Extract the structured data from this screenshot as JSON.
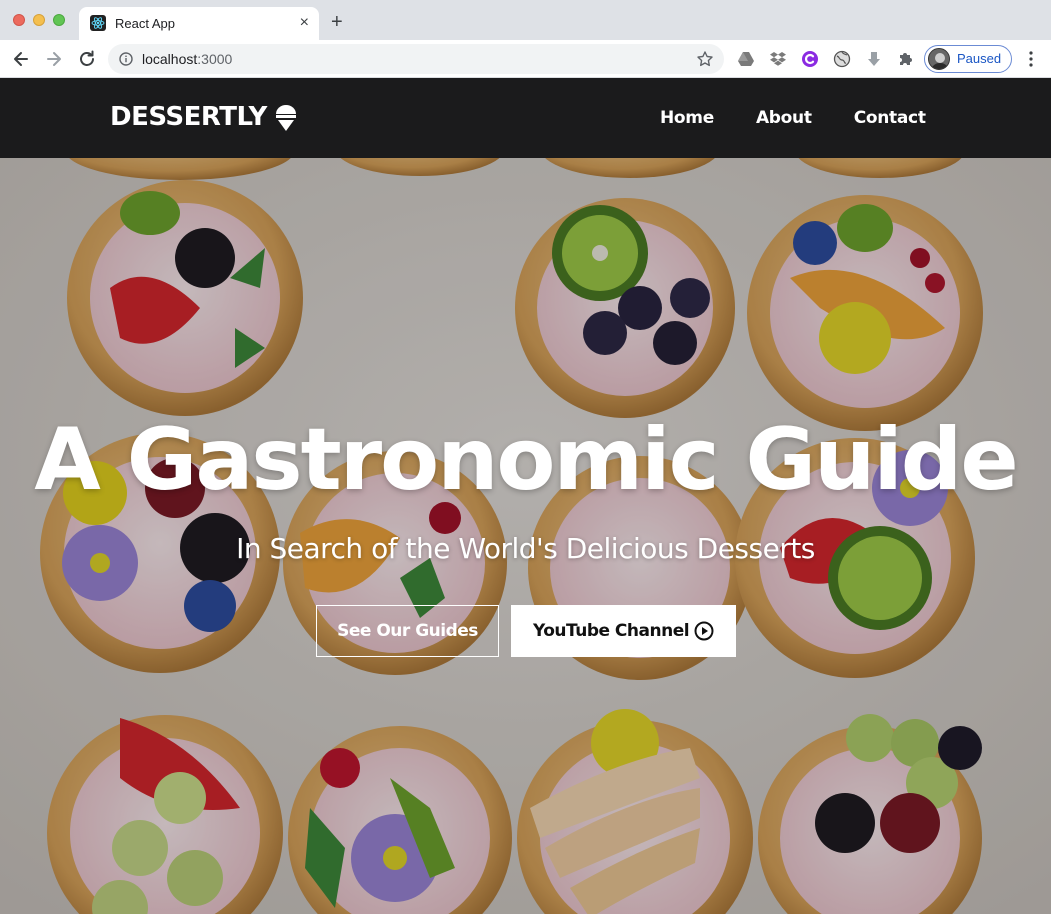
{
  "browser": {
    "tab_title": "React App",
    "tab_close": "×",
    "new_tab": "+",
    "url_host": "localhost",
    "url_port": ":3000",
    "profile_label": "Paused"
  },
  "site": {
    "brand": "DESSERTLY",
    "nav": [
      {
        "label": "Home"
      },
      {
        "label": "About"
      },
      {
        "label": "Contact"
      }
    ],
    "hero": {
      "title": "A Gastronomic Guide",
      "subtitle": "In Search of the World's Delicious Desserts",
      "primary_button": "See Our Guides",
      "secondary_button": "YouTube Channel"
    }
  },
  "colors": {
    "navbar_bg": "#1b1b1c",
    "hero_text": "#ffffff",
    "profile_accent": "#1a56c4"
  },
  "icons": {
    "brand": "ice-cream-icon",
    "youtube_button": "play-circle-icon"
  }
}
